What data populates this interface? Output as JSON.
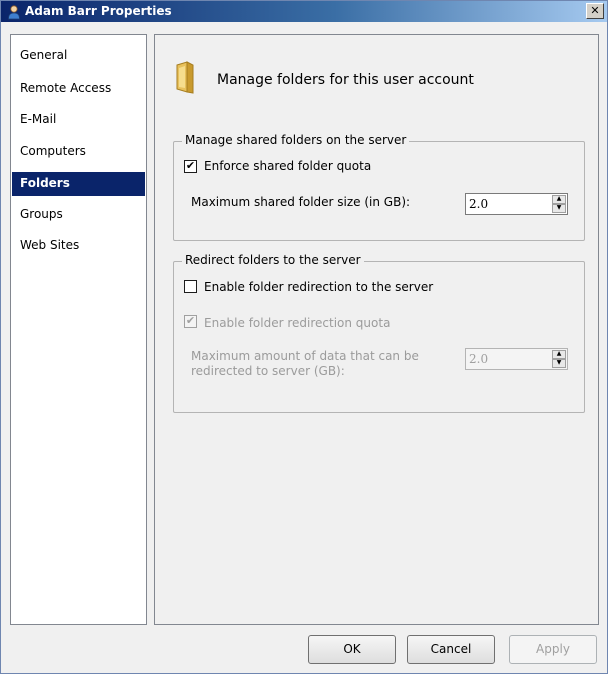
{
  "window": {
    "title": "Adam Barr Properties",
    "close_glyph": "✕"
  },
  "sidebar": {
    "items": [
      {
        "label": "General",
        "selected": false
      },
      {
        "label": "Remote Access",
        "selected": false
      },
      {
        "label": "E-Mail",
        "selected": false
      },
      {
        "label": "Computers",
        "selected": false
      },
      {
        "label": "Folders",
        "selected": true
      },
      {
        "label": "Groups",
        "selected": false
      },
      {
        "label": "Web Sites",
        "selected": false
      }
    ]
  },
  "panel": {
    "heading": "Manage folders for this user account",
    "shared_group": {
      "legend": "Manage shared folders on the server",
      "enforce_quota_label": "Enforce shared folder quota",
      "enforce_quota_checked": true,
      "max_size_label": "Maximum shared folder size (in GB):",
      "max_size_value": "2.0"
    },
    "redirect_group": {
      "legend": "Redirect folders to the server",
      "enable_redirect_label": "Enable folder redirection to the server",
      "enable_redirect_checked": false,
      "redirect_quota_label": "Enable folder redirection quota",
      "redirect_quota_checked": true,
      "redirect_quota_enabled": false,
      "max_data_label_line1": "Maximum amount of data that can be",
      "max_data_label_line2": "redirected to server (GB):",
      "max_data_value": "2.0"
    }
  },
  "buttons": {
    "ok": "OK",
    "cancel": "Cancel",
    "apply": "Apply",
    "apply_enabled": false
  },
  "colors": {
    "selected_bg": "#0a246a",
    "titlebar_start": "#0a246a",
    "titlebar_end": "#a6caf0"
  }
}
